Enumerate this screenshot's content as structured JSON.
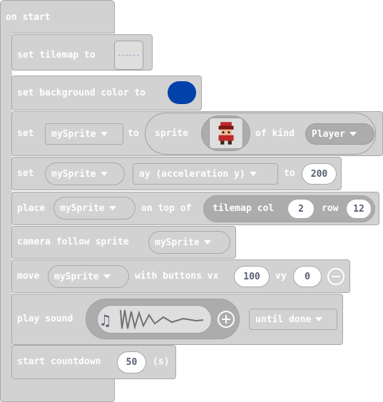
{
  "colors": {
    "block": "#d2d2d2",
    "block_border": "#a9a9a9",
    "dark_pill": "#acacac",
    "background_color_value": "#0041aa",
    "number_text": "#575e75"
  },
  "on_start": {
    "label": "on start"
  },
  "tilemap": {
    "label": "set tilemap to"
  },
  "bg": {
    "label": "set background color to"
  },
  "set_sprite": {
    "set": "set",
    "var": "mySprite",
    "to": "to",
    "sprite": "sprite",
    "of_kind": "of kind",
    "kind": "Player"
  },
  "set_ay": {
    "set": "set",
    "var": "mySprite",
    "prop": "ay (acceleration y)",
    "to": "to",
    "value": "200"
  },
  "place": {
    "label": "place",
    "var": "mySprite",
    "on_top_of": "on top of",
    "tilemap_col": "tilemap col",
    "col": "2",
    "row_label": "row",
    "row": "12"
  },
  "camera": {
    "label": "camera follow sprite",
    "var": "mySprite"
  },
  "move": {
    "label": "move",
    "var": "mySprite",
    "with": "with buttons vx",
    "vx": "100",
    "vy_label": "vy",
    "vy": "0"
  },
  "sound": {
    "label": "play sound",
    "mode": "until done"
  },
  "countdown": {
    "label": "start countdown",
    "value": "50",
    "unit": "(s)"
  }
}
